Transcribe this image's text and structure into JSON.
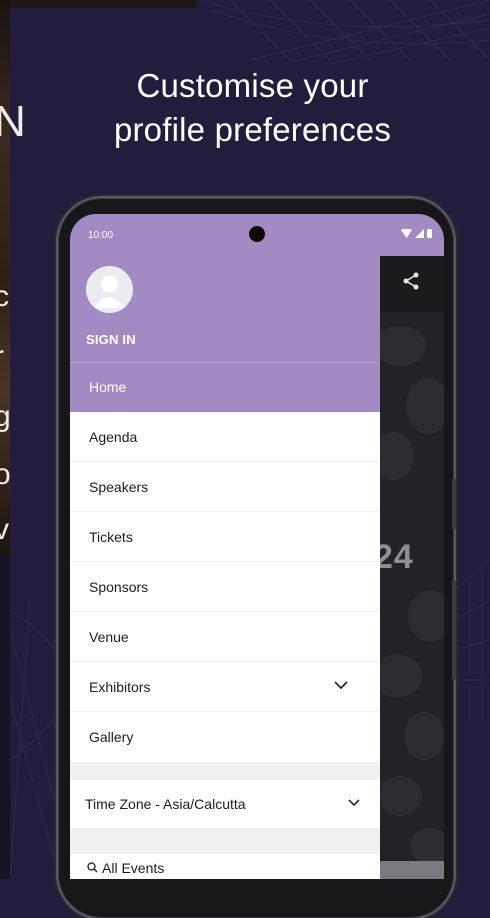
{
  "headline": {
    "line1": "Customise your",
    "line2": "profile preferences"
  },
  "left_photo_glyphs": [
    "N",
    "c",
    "r",
    "g",
    "o",
    "v"
  ],
  "phone": {
    "status_time": "10:00",
    "status_icons": [
      "wifi-icon",
      "signal-icon",
      "battery-icon"
    ],
    "background_app": {
      "share_icon": "share-icon",
      "number_fragment": "24"
    },
    "drawer": {
      "sign_in_label": "SIGN IN",
      "avatar_icon": "user-avatar-icon",
      "active_item": "Home",
      "items": [
        {
          "label": "Agenda"
        },
        {
          "label": "Speakers"
        },
        {
          "label": "Tickets"
        },
        {
          "label": "Sponsors"
        },
        {
          "label": "Venue"
        },
        {
          "label": "Exhibitors",
          "expandable": true
        },
        {
          "label": "Gallery"
        }
      ],
      "timezone_label": "Time Zone - Asia/Calcutta",
      "all_events_label": "All Events"
    }
  },
  "colors": {
    "background": "#231d3d",
    "drawer_accent": "#a28ac2",
    "text_dark": "#1c1c1f"
  }
}
